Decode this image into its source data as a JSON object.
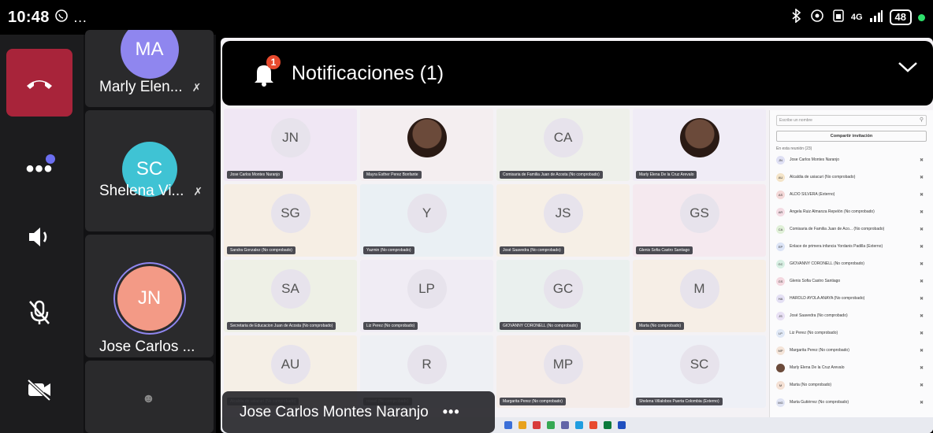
{
  "status": {
    "time": "10:48",
    "extra_icons": "…",
    "network": "4G",
    "battery": "48"
  },
  "participants_strip": [
    {
      "initials": "MA",
      "name": "Marly Elen...",
      "color": "#8f86ef"
    },
    {
      "initials": "SC",
      "name": "Shelena Vi...",
      "color": "#3fc3d4"
    },
    {
      "initials": "JN",
      "name": "Jose Carlos ...",
      "color": "#f39a86"
    }
  ],
  "notification": {
    "title": "Notificaciones (1)",
    "count": "1"
  },
  "speaker": {
    "name": "Jose Carlos Montes Naranjo"
  },
  "shared_screen": {
    "grid": [
      {
        "initials": "JN",
        "label": "Jose Carlos Montes Naranjo",
        "photo": false,
        "bg": "#f0e7f4"
      },
      {
        "initials": "",
        "label": "Mayra Esther Perez Bonfante",
        "photo": true,
        "bg": "#f4eef0"
      },
      {
        "initials": "CA",
        "label": "Comisaria de Familia Juan de Acosta (No comprobado)",
        "photo": false,
        "bg": "#eef0ea"
      },
      {
        "initials": "",
        "label": "Marly Elena De la Cruz Arevalo",
        "photo": true,
        "bg": "#f0ecf6"
      },
      {
        "initials": "SG",
        "label": "Sandra Gonzalez (No comprobado)",
        "photo": false,
        "bg": "#f6eee4"
      },
      {
        "initials": "Y",
        "label": "Yazmin (No comprobado)",
        "photo": false,
        "bg": "#eaf0f4"
      },
      {
        "initials": "JS",
        "label": "José Saavedra (No comprobado)",
        "photo": false,
        "bg": "#f6efe6"
      },
      {
        "initials": "GS",
        "label": "Glenis Sofia Castro Santiago",
        "photo": false,
        "bg": "#f5e9ef"
      },
      {
        "initials": "SA",
        "label": "Secretaria de Educacion Juan de Acosta (No comprobado)",
        "photo": false,
        "bg": "#eef0e6"
      },
      {
        "initials": "LP",
        "label": "Liz Perez (No comprobado)",
        "photo": false,
        "bg": "#f0ecf4"
      },
      {
        "initials": "GC",
        "label": "GIOVANNY CORONELL (No comprobado)",
        "photo": false,
        "bg": "#eaf0ee"
      },
      {
        "initials": "M",
        "label": "Marta (No comprobado)",
        "photo": false,
        "bg": "#f6eee6"
      },
      {
        "initials": "AU",
        "label": "Alcaldia de usiacuri (No comprobado)",
        "photo": false,
        "bg": "#f5efe6"
      },
      {
        "initials": "R",
        "label": "rossel (No comprobado)",
        "photo": false,
        "bg": "#eef0f4"
      },
      {
        "initials": "MP",
        "label": "Margarita Perez (No comprobado)",
        "photo": false,
        "bg": "#f4ece9"
      },
      {
        "initials": "SC",
        "label": "Shelena Villalobos Puerta Colombia (Externo)",
        "photo": false,
        "bg": "#eef0f6"
      }
    ],
    "panel": {
      "search_placeholder": "Escribe un nombre",
      "share_label": "Compartir invitación",
      "section_label": "En esta reunión (23)",
      "people": [
        {
          "initials": "JN",
          "name": "Jose Carlos Montes Naranjo",
          "color": "#dfe0f4"
        },
        {
          "initials": "AU",
          "name": "Alcaldia de usiacuri (No comprobado)",
          "color": "#f4e4c8"
        },
        {
          "initials": "AS",
          "name": "ALDO SILVERA (Externo)",
          "color": "#f4d8d8"
        },
        {
          "initials": "AR",
          "name": "Angela Ruiz Almanza Repelón (No comprobado)",
          "color": "#f4dce4"
        },
        {
          "initials": "CA",
          "name": "Comisaria de Familia Juan de Aco... (No comprobado)",
          "color": "#e0f0d8"
        },
        {
          "initials": "EP",
          "name": "Enlace de primera infancia Yordanis Padilla (Externo)",
          "color": "#dce4f6"
        },
        {
          "initials": "GC",
          "name": "GIOVANNY CORONELL (No comprobado)",
          "color": "#d8f0e4"
        },
        {
          "initials": "GS",
          "name": "Glenis Sofia Castro Santiago",
          "color": "#f4d8e0"
        },
        {
          "initials": "HA",
          "name": "HAROLD AYOLA ANAYA (No comprobado)",
          "color": "#e4e0f4"
        },
        {
          "initials": "JS",
          "name": "José Saavedra (No comprobado)",
          "color": "#e8e0f4"
        },
        {
          "initials": "LP",
          "name": "Liz Perez (No comprobado)",
          "color": "#e0e8f6"
        },
        {
          "initials": "MP",
          "name": "Margarita Perez (No comprobado)",
          "color": "#f4e4d8"
        },
        {
          "initials": "",
          "name": "Marly Elena De la Cruz Arevalo",
          "color": "#6b4a3a"
        },
        {
          "initials": "M",
          "name": "Marta (No comprobado)",
          "color": "#f4e0d4"
        },
        {
          "initials": "MG",
          "name": "Marta Gutiérrez (No comprobado)",
          "color": "#e0e4f4"
        }
      ]
    }
  }
}
